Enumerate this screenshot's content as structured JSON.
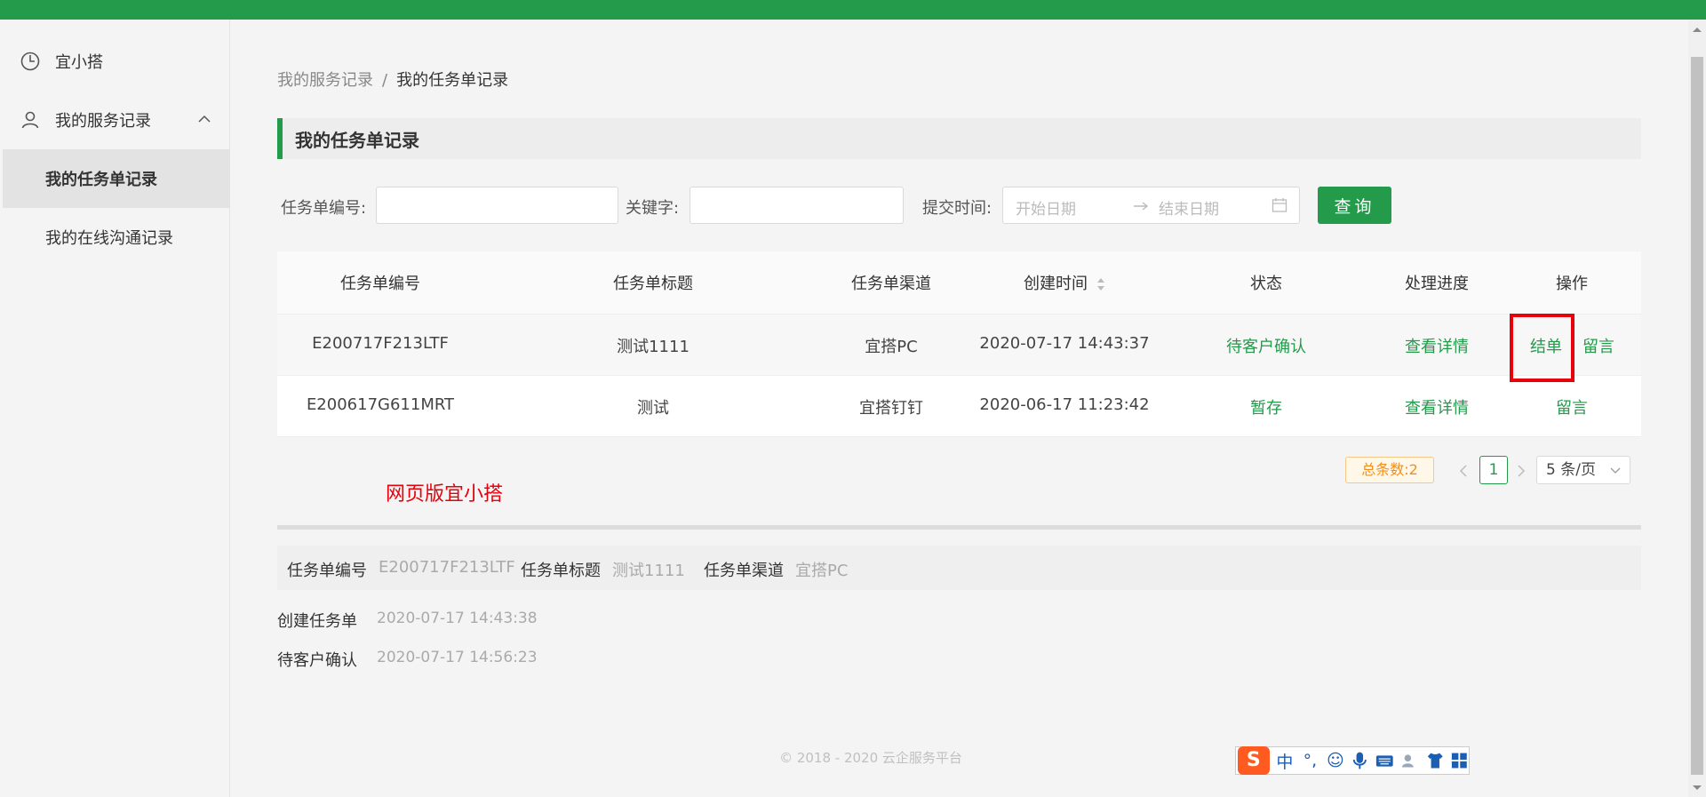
{
  "sidebar": {
    "items": [
      {
        "label": "宜小搭",
        "icon": "clock-icon"
      },
      {
        "label": "我的服务记录",
        "icon": "user-icon"
      }
    ],
    "sub_items": [
      {
        "label": "我的任务单记录",
        "active": true
      },
      {
        "label": "我的在线沟通记录",
        "active": false
      }
    ]
  },
  "breadcrumb": {
    "parent": "我的服务记录",
    "separator": "/",
    "current": "我的任务单记录"
  },
  "section_title": "我的任务单记录",
  "filters": {
    "ticket_no_label": "任务单编号:",
    "ticket_no_value": "",
    "keyword_label": "关键字:",
    "keyword_value": "",
    "submit_time_label": "提交时间:",
    "start_placeholder": "开始日期",
    "end_placeholder": "结束日期",
    "query_button": "查询"
  },
  "table": {
    "headers": [
      "任务单编号",
      "任务单标题",
      "任务单渠道",
      "创建时间",
      "状态",
      "处理进度",
      "操作"
    ],
    "rows": [
      {
        "ticket_no": "E200717F213LTF",
        "title": "测试1111",
        "channel": "宜搭PC",
        "created": "2020-07-17 14:43:37",
        "status": "待客户确认",
        "progress": "查看详情",
        "actions": [
          "结单",
          "留言"
        ]
      },
      {
        "ticket_no": "E200617G611MRT",
        "title": "测试",
        "channel": "宜搭钉钉",
        "created": "2020-06-17 11:23:42",
        "status": "暂存",
        "progress": "查看详情",
        "actions": [
          "留言"
        ]
      }
    ]
  },
  "pagination": {
    "total": "总条数:2",
    "current_page": "1",
    "page_size": "5 条/页"
  },
  "annotation": "网页版宜小搭",
  "detail": {
    "ticket_no_label": "任务单编号",
    "ticket_no_value": "E200717F213LTF",
    "title_label": "任务单标题",
    "title_value": "测试1111",
    "channel_label": "任务单渠道",
    "channel_value": "宜搭PC",
    "timeline": [
      {
        "label": "创建任务单",
        "time": "2020-07-17 14:43:38"
      },
      {
        "label": "待客户确认",
        "time": "2020-07-17 14:56:23"
      }
    ]
  },
  "footer": "© 2018 - 2020 云企服务平台",
  "ime": {
    "logo": "S",
    "mode": "中"
  },
  "colors": {
    "accent": "#249a4b",
    "highlight": "#e8000b",
    "badge": "#f38f1b"
  }
}
